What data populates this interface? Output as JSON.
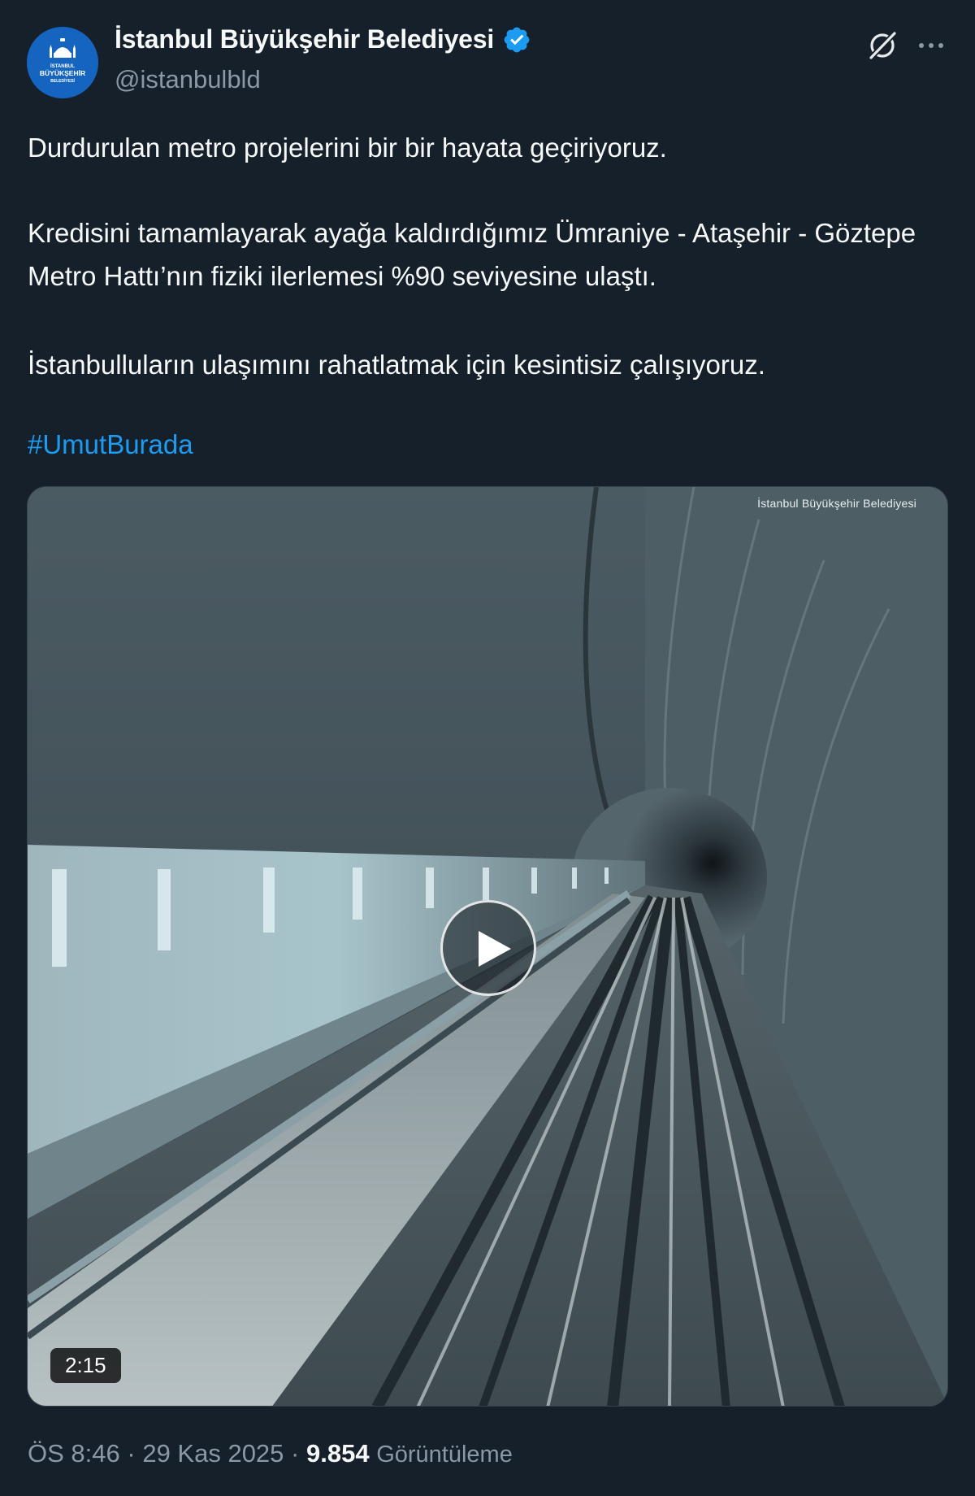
{
  "author": {
    "display_name": "İstanbul Büyükşehir Belediyesi",
    "handle": "@istanbulbld",
    "verified": true,
    "avatar_logo_text": [
      "İSTANBUL",
      "BÜYÜKŞEHİR",
      "BELEDİYESİ"
    ],
    "avatar_color": "#1565c0"
  },
  "header_actions": {
    "grok_icon": "grok-icon",
    "more_icon": "more-options-icon"
  },
  "tweet": {
    "paragraphs": [
      "Durdurulan metro projelerini bir bir hayata geçiriyoruz.",
      "Kredisini tamamlayarak ayağa kaldırdığımız Ümraniye - Ataşehir - Göztepe Metro Hattı’nın fiziki ilerlemesi %90 seviyesine ulaştı.",
      "İstanbulluların ulaşımını rahatlatmak için kesintisiz çalışıyoruz."
    ],
    "hashtag": "#UmutBurada"
  },
  "media": {
    "type": "video",
    "watermark": "İstanbul Büyükşehir Belediyesi",
    "duration": "2:15",
    "play_icon": "play-icon"
  },
  "meta": {
    "time": "ÖS 8:46",
    "separator": "·",
    "date": "29 Kas 2025",
    "views_count": "9.854",
    "views_label": "Görüntüleme"
  },
  "colors": {
    "background": "#15202b",
    "text_primary": "#f7f9f9",
    "text_secondary": "#8b98a5",
    "link": "#1d9bf0",
    "verified_badge": "#1d9bf0"
  }
}
